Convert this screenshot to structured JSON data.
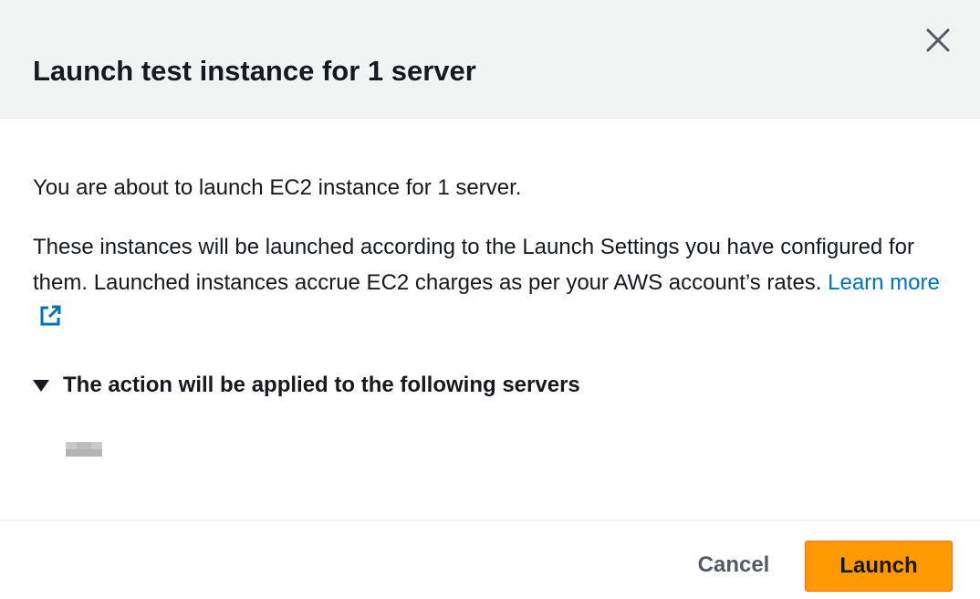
{
  "modal": {
    "title": "Launch test instance for 1 server",
    "close_icon": "close-icon"
  },
  "body": {
    "intro": "You are about to launch EC2 instance for 1 server.",
    "description": "These instances will be launched according to the Launch Settings you have configured for them. Launched instances accrue EC2 charges as per your AWS account’s rates. ",
    "learn_more_label": "Learn more",
    "external_link_icon": "external-link-icon",
    "link_color": "#0073bb"
  },
  "servers_section": {
    "label": "The action will be applied to the following servers",
    "expanded": true,
    "caret_icon": "caret-down-icon",
    "servers": [
      "[redacted]"
    ]
  },
  "footer": {
    "cancel_label": "Cancel",
    "launch_label": "Launch",
    "primary_color": "#ff9900"
  }
}
